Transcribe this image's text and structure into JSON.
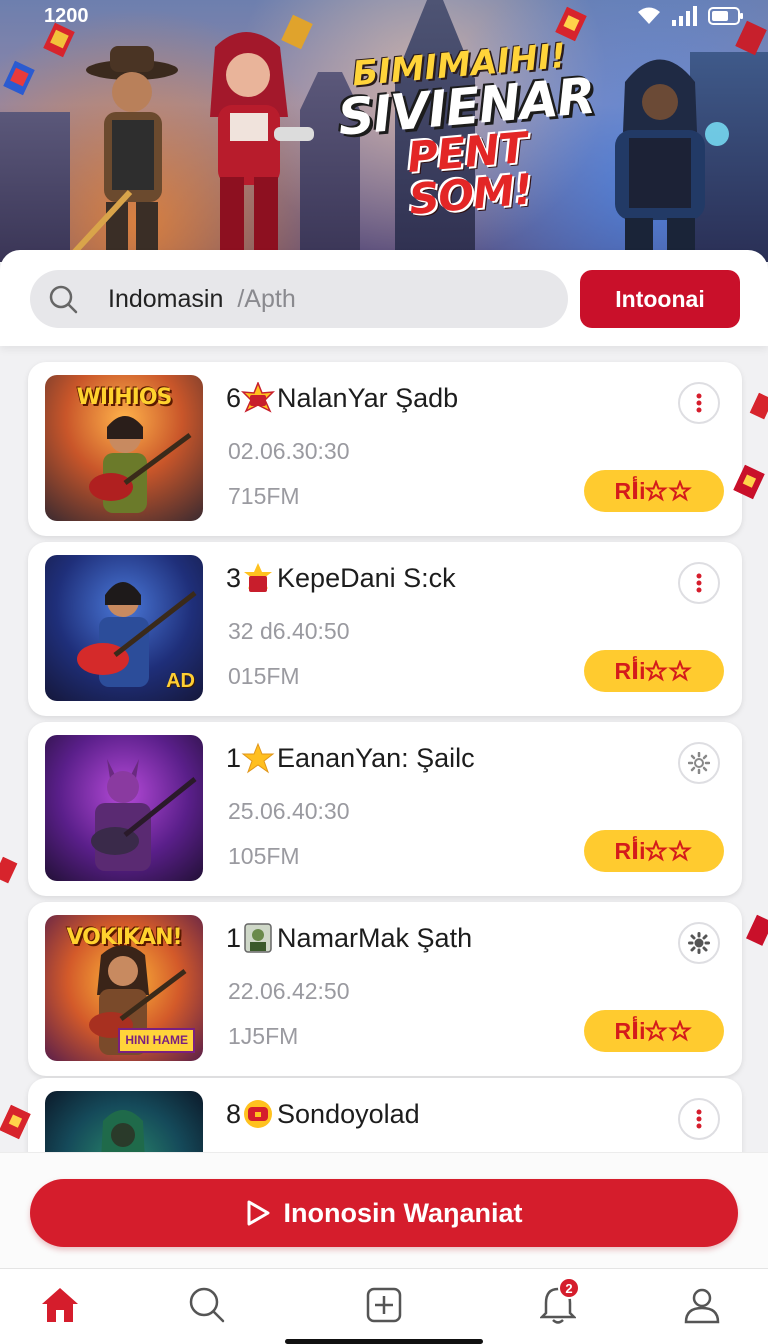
{
  "status_bar": {
    "time": "1200"
  },
  "hero": {
    "title_line1": "БIMIMAIНI!",
    "title_line2": "SIVIENAR",
    "title_line3": "PENT SOM!"
  },
  "search": {
    "value": "Indomasin",
    "placeholder": "/Apth",
    "button_label": "Intoonai"
  },
  "items": [
    {
      "rank": "6",
      "title": "NalanYar Şadb",
      "time": "02.06.30:30",
      "size": "715FM",
      "rating_label": "Rأi",
      "thumb_label": "WIIHIOS",
      "thumb_corner": "",
      "icon": "burst-icon",
      "menu": "more"
    },
    {
      "rank": "3",
      "title": "KepeDani S:ck",
      "time": "32 d6.40:50",
      "size": "015FM",
      "rating_label": "Rأi",
      "thumb_label": "",
      "thumb_corner": "AD",
      "icon": "gift-icon",
      "menu": "more"
    },
    {
      "rank": "1",
      "title": "EananYan: Şailc",
      "time": "25.06.40:30",
      "size": "105FM",
      "rating_label": "Rأi",
      "thumb_label": "",
      "thumb_corner": "",
      "icon": "star-icon",
      "menu": "settings"
    },
    {
      "rank": "1",
      "title": "NamarMak Şath",
      "time": "22.06.42:50",
      "size": "1J5FM",
      "rating_label": "Rأi",
      "thumb_label": "VOKIKAN!",
      "thumb_corner": "HINI HAME",
      "icon": "avatar-icon",
      "menu": "settings"
    },
    {
      "rank": "8",
      "title": "Sondoyolad",
      "time": "",
      "size": "",
      "rating_label": "",
      "thumb_label": "",
      "thumb_corner": "",
      "icon": "chest-icon",
      "menu": "more"
    }
  ],
  "cta": {
    "label": "Inonosin Waŋaniat"
  },
  "tabbar": {
    "items": [
      "home-icon",
      "search-icon",
      "add-icon",
      "bell-icon",
      "profile-icon"
    ],
    "notification_count": "2"
  },
  "colors": {
    "accent": "#d51d2c",
    "badge_yellow": "#ffcb2f"
  }
}
